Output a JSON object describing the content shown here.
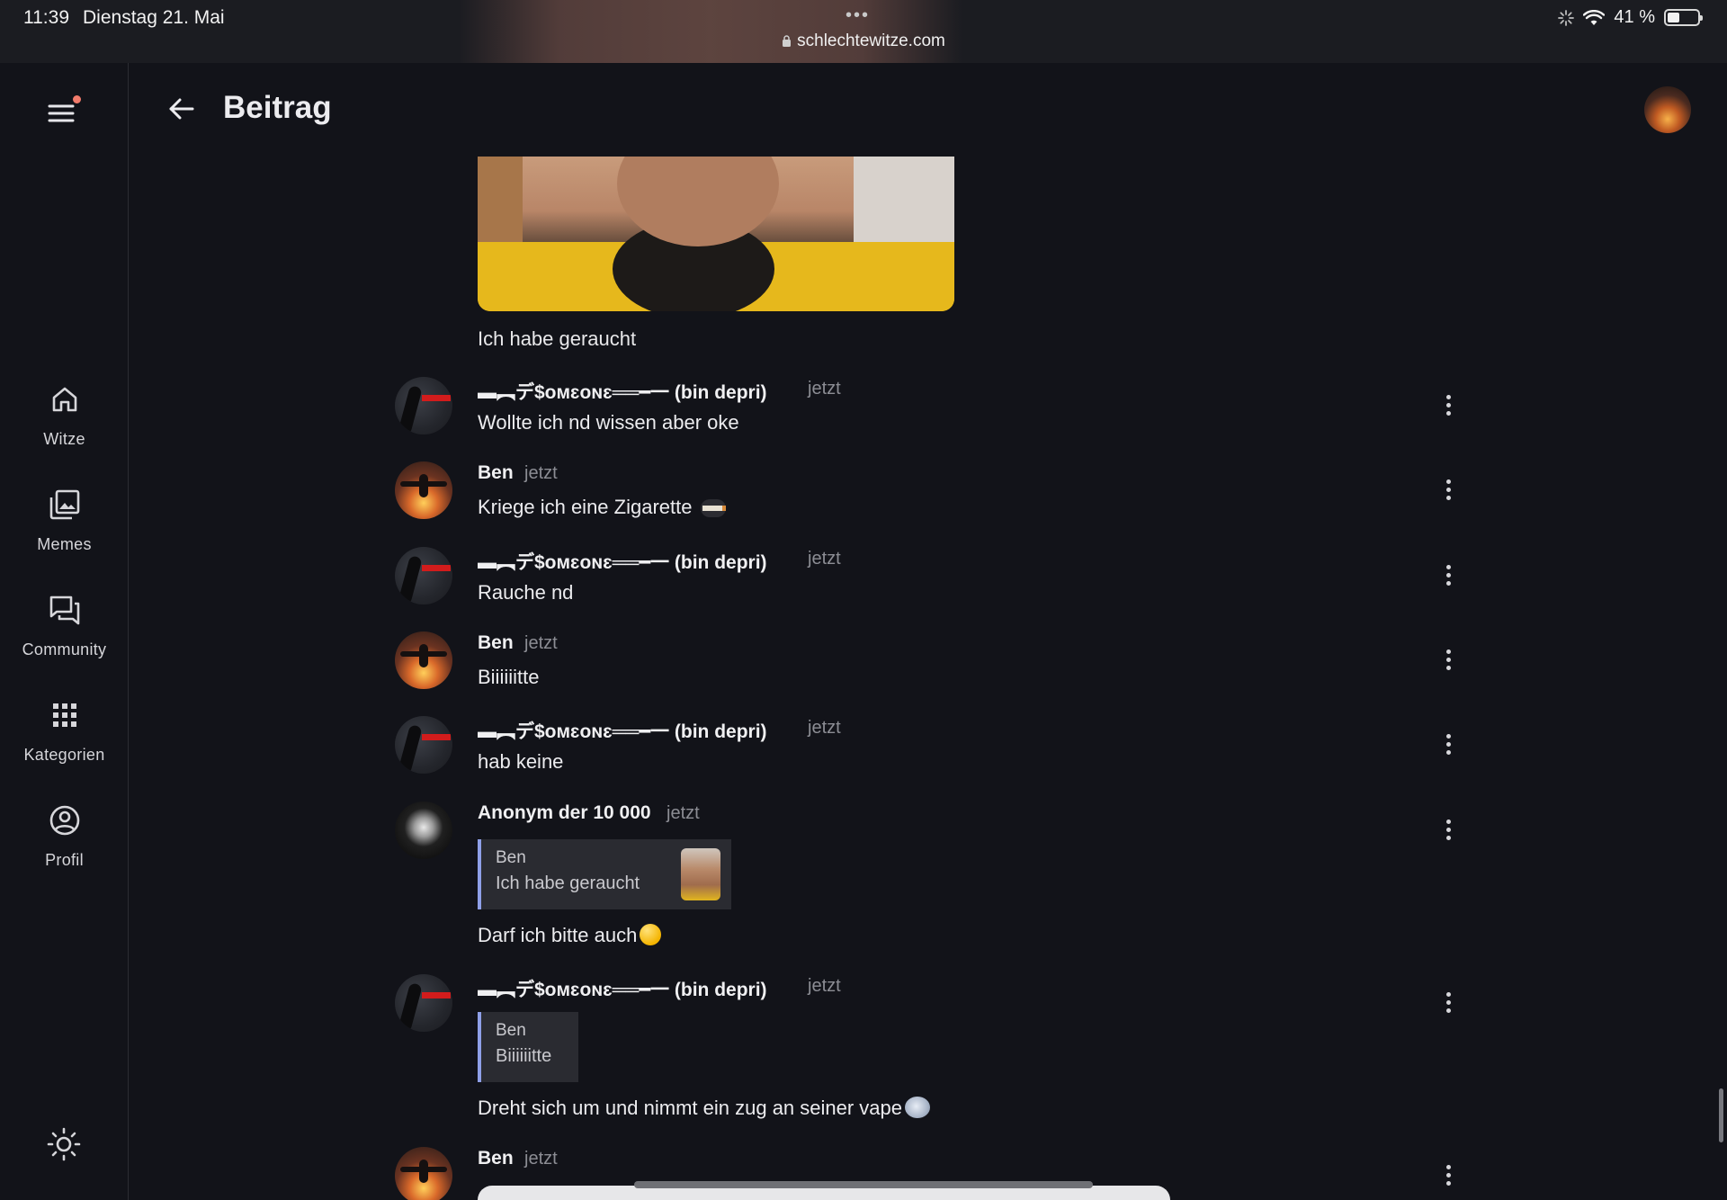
{
  "status_bar": {
    "time": "11:39",
    "date": "Dienstag 21. Mai",
    "url": "schlechtewitze.com",
    "battery": "41 %",
    "battery_level": 0.41
  },
  "header": {
    "title": "Beitrag",
    "back_icon": "arrow-left-icon"
  },
  "sidebar": {
    "menu_icon": "hamburger-menu-icon",
    "items": [
      {
        "label": "Witze",
        "icon": "home-icon"
      },
      {
        "label": "Memes",
        "icon": "image-gallery-icon"
      },
      {
        "label": "Community",
        "icon": "chat-bubbles-icon"
      },
      {
        "label": "Kategorien",
        "icon": "grid-apps-icon"
      },
      {
        "label": "Profil",
        "icon": "user-circle-icon"
      }
    ],
    "theme_icon": "sun-icon"
  },
  "post": {
    "caption": "Ich habe geraucht"
  },
  "comments": [
    {
      "author": "▬︻デ$ᴏᴍɛᴏɴɛ══━一 (bin depri)",
      "time": "jetzt",
      "text": "Wollte ich nd wissen aber oke"
    },
    {
      "author": "Ben",
      "time": "jetzt",
      "text": "Kriege ich eine Zigarette",
      "emoji": "cigarette-emoji"
    },
    {
      "author": "▬︻デ$ᴏᴍɛᴏɴɛ══━一 (bin depri)",
      "time": "jetzt",
      "text": "Rauche nd"
    },
    {
      "author": "Ben",
      "time": "jetzt",
      "text": "Biiiiiitte"
    },
    {
      "author": "▬︻デ$ᴏᴍɛᴏɴɛ══━一 (bin depri)",
      "time": "jetzt",
      "text": "hab keine"
    },
    {
      "author": "Anonym der 10 000",
      "time": "jetzt",
      "quote": {
        "author": "Ben",
        "text": "Ich habe geraucht"
      },
      "text": "Darf ich bitte auch",
      "emoji": "pleading-face-emoji"
    },
    {
      "author": "▬︻デ$ᴏᴍɛᴏɴɛ══━一 (bin depri)",
      "time": "jetzt",
      "quote": {
        "author": "Ben",
        "text": "Biiiiiitte"
      },
      "text": "Dreht sich um und nimmt ein zug an seiner vape",
      "emoji": "dash-emoji"
    },
    {
      "author": "Ben",
      "time": "jetzt"
    }
  ],
  "colors": {
    "background": "#121319",
    "quote_border": "#8fa0e8",
    "notification_dot": "#f27b6b"
  }
}
